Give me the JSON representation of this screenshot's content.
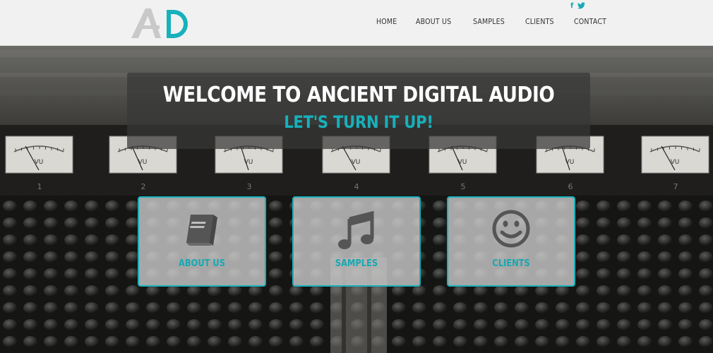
{
  "header": {
    "logo_text": "AD",
    "nav": [
      "HOME",
      "ABOUT US",
      "SAMPLES",
      "CLIENTS",
      "CONTACT"
    ],
    "social": {
      "facebook": "f",
      "twitter": "t"
    }
  },
  "hero": {
    "title": "WELCOME TO ANCIENT DIGITAL AUDIO",
    "subtitle": "LET'S TURN IT UP!",
    "meter_numbers": [
      "1",
      "2",
      "3",
      "4",
      "5",
      "6",
      "7"
    ],
    "meter_label": "VU",
    "cards": [
      {
        "label": "ABOUT US",
        "icon": "book-icon"
      },
      {
        "label": "SAMPLES",
        "icon": "music-note-icon"
      },
      {
        "label": "CLIENTS",
        "icon": "smiley-icon"
      }
    ]
  },
  "colors": {
    "accent": "#17b1bb",
    "header_bg": "#f1f1f1"
  }
}
